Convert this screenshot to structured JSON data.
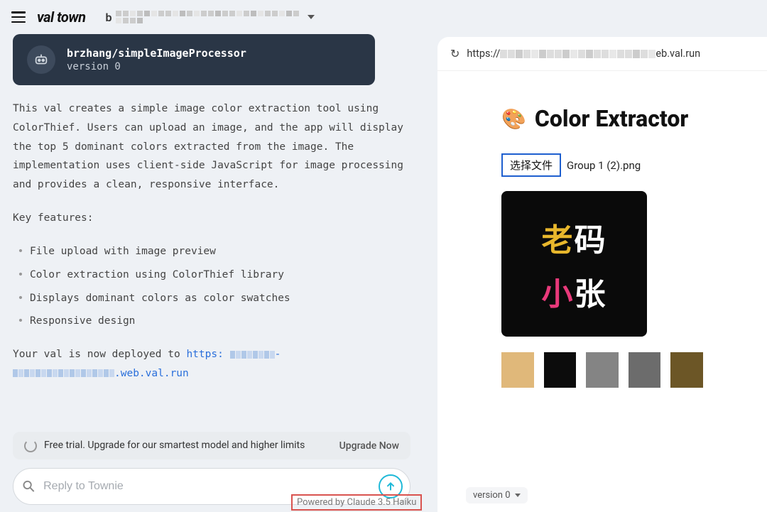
{
  "brand": "val town",
  "breadcrumb_first": "b",
  "val_header": {
    "path": "brzhang/simpleImageProcessor",
    "version": "version 0"
  },
  "description": {
    "p1": "This val creates a simple image color extraction tool using ColorThief. Users can upload an image, and the app will display the top 5 dominant colors extracted from the image. The implementation uses client-side JavaScript for image processing and provides a clean, responsive interface.",
    "key_features_title": "Key features:",
    "features": [
      "File upload with image preview",
      "Color extraction using ColorThief library",
      "Displays dominant colors as color swatches",
      "Responsive design"
    ],
    "deployed_prefix": "Your val is now deployed to ",
    "deployed_link_start": "https:",
    "deployed_link_end": ".web.val.run"
  },
  "upgrade": {
    "message": "Free trial. Upgrade for our smartest model and higher limits",
    "button": "Upgrade Now"
  },
  "reply": {
    "placeholder": "Reply to Townie"
  },
  "powered_by": "Powered by Claude 3.5 Haiku",
  "browser": {
    "url_prefix": "https://",
    "url_suffix": "eb.val.run"
  },
  "preview": {
    "title": "Color Extractor",
    "emoji": "🎨",
    "file_button": "选择文件",
    "file_name": "Group 1 (2).png",
    "image_text": {
      "line1a": "老",
      "line1b": "码",
      "line2a": "小",
      "line2b": "张"
    },
    "swatches": [
      "#e0b87a",
      "#0c0c0c",
      "#848484",
      "#6c6c6c",
      "#6c5626"
    ]
  },
  "version_selector": "version 0"
}
